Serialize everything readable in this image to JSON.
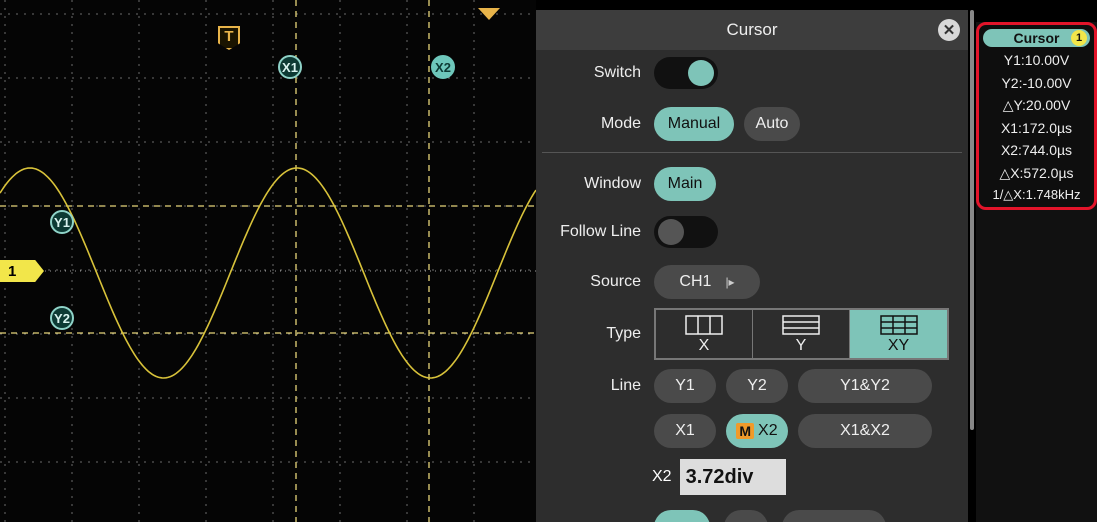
{
  "scope": {
    "trigger_label": "T",
    "channel_label": "1",
    "markers": {
      "x1": "X1",
      "x2": "X2",
      "y1": "Y1",
      "y2": "Y2"
    },
    "trace_color": "#d8c23a",
    "grid_color": "#6a6a6a",
    "cursor_color": "#e6d57a"
  },
  "dialog": {
    "title": "Cursor",
    "close_icon": "close-icon",
    "switch_label": "Switch",
    "switch_on": true,
    "mode_label": "Mode",
    "mode_options": [
      "Manual",
      "Auto"
    ],
    "mode_selected": "Manual",
    "window_label": "Window",
    "window_value": "Main",
    "follow_label": "Follow Line",
    "follow_on": false,
    "source_label": "Source",
    "source_value": "CH1",
    "type_label": "Type",
    "type_options": [
      "X",
      "Y",
      "XY"
    ],
    "type_selected": "XY",
    "line_label": "Line",
    "line_row1": [
      "Y1",
      "Y2",
      "Y1&Y2"
    ],
    "line_row2_x1": "X1",
    "line_row2_m": "M",
    "line_row2_x2": "X2",
    "line_row2_both": "X1&X2",
    "x2_field_label": "X2",
    "x2_field_value": "3.72div"
  },
  "readout": {
    "title": "Cursor",
    "channel": "1",
    "lines": [
      "Y1:10.00V",
      "Y2:-10.00V",
      "△Y:20.00V",
      "X1:172.0µs",
      "X2:744.0µs",
      "△X:572.0µs",
      "1/△X:1.748kHz"
    ]
  },
  "colors": {
    "accent": "#7ec4b8",
    "highlight": "#e3142a",
    "trigger": "#e8b44a",
    "channel": "#f2e64a"
  }
}
